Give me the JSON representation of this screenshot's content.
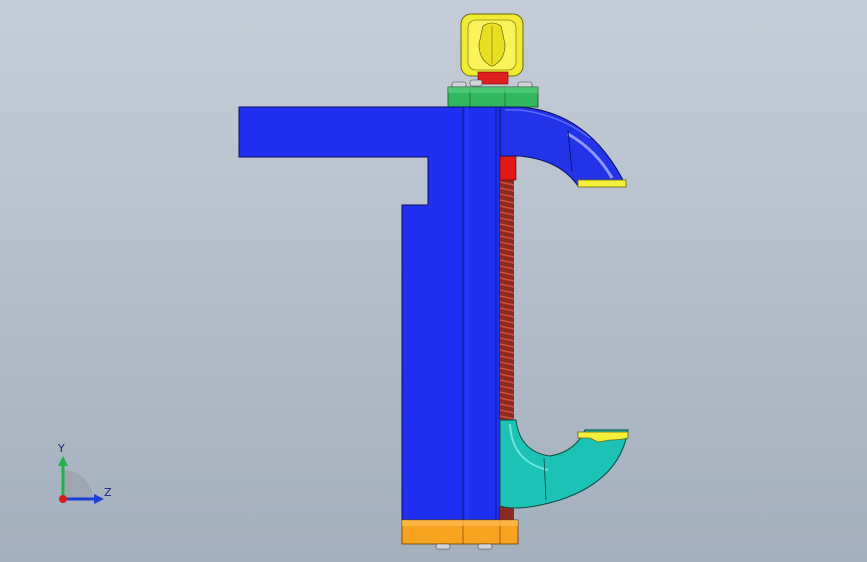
{
  "view": {
    "background_top": "#c5cdd8",
    "background_bottom": "#a4afbd"
  },
  "triad": {
    "y_label": "Y",
    "z_label": "Z",
    "y_color": "#22b24c",
    "z_color": "#1a3fd6",
    "origin_color": "#d81b1b"
  },
  "model": {
    "parts": [
      {
        "name": "knob",
        "color": "#f4ef3a"
      },
      {
        "name": "collar",
        "color": "#2fb35c"
      },
      {
        "name": "frame-body",
        "color": "#1f2ff0"
      },
      {
        "name": "upper-jaw",
        "color": "#2331e6"
      },
      {
        "name": "lead-screw",
        "color": "#b02a1e"
      },
      {
        "name": "lower-jaw",
        "color": "#1fc1b6"
      },
      {
        "name": "base-plate",
        "color": "#f4a21f"
      }
    ]
  }
}
